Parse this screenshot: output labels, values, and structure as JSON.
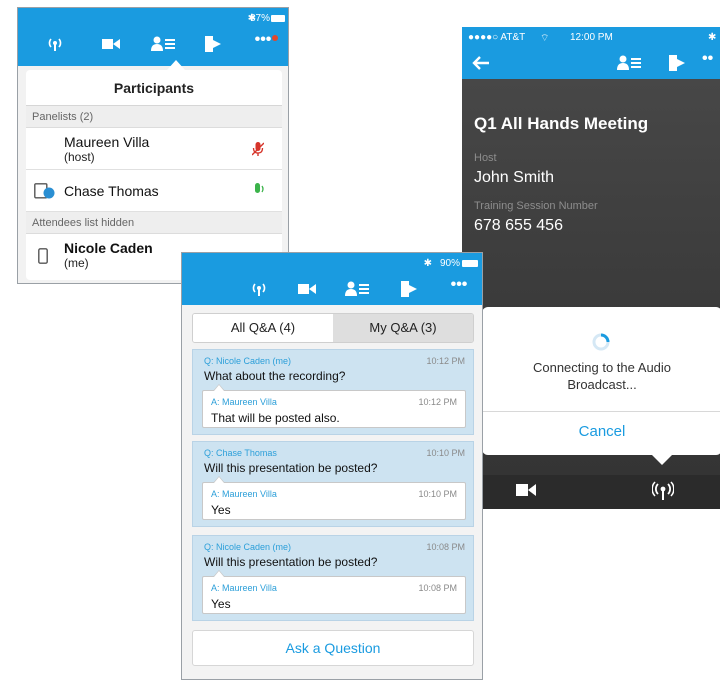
{
  "colors": {
    "accent": "#1a9be0",
    "question_bg": "#cde3f1",
    "dark_bg": "#3a3a3a"
  },
  "participants_screen": {
    "status": {
      "battery": "87%"
    },
    "toolbar_icons": [
      "audio-broadcast-icon",
      "video-icon",
      "participants-icon",
      "leave-icon",
      "more-icon"
    ],
    "title": "Participants",
    "panelists_header": "Panelists (2)",
    "panelists": [
      {
        "name": "Maureen Villa",
        "sub": "(host)",
        "mic": "muted-mic-icon"
      },
      {
        "name": "Chase Thomas",
        "sub": "",
        "mic": "active-mic-icon"
      }
    ],
    "attendees_header": "Attendees list hidden",
    "me": {
      "name": "Nicole Caden",
      "sub": "(me)"
    }
  },
  "meeting_screen": {
    "status": {
      "carrier": "●●●●○ AT&T",
      "time": "12:00 PM"
    },
    "title": "Q1 All Hands Meeting",
    "host_label": "Host",
    "host_value": "John Smith",
    "session_label": "Training Session Number",
    "session_value": "678 655 456",
    "dialog": {
      "message": "Connecting to the Audio Broadcast...",
      "cancel": "Cancel"
    }
  },
  "qa_screen": {
    "status": {
      "battery": "90%"
    },
    "tabs": [
      {
        "label": "All Q&A (4)"
      },
      {
        "label": "My Q&A (3)"
      }
    ],
    "items": [
      {
        "q_from": "Q: Nicole Caden (me)",
        "q_time": "10:12 PM",
        "q_text": "What about the recording?",
        "a_from": "A: Maureen Villa",
        "a_time": "10:12 PM",
        "a_text": "That will be posted also."
      },
      {
        "q_from": "Q: Chase Thomas",
        "q_time": "10:10 PM",
        "q_text": "Will this presentation be posted?",
        "a_from": "A: Maureen Villa",
        "a_time": "10:10 PM",
        "a_text": "Yes"
      },
      {
        "q_from": "Q: Nicole Caden (me)",
        "q_time": "10:08 PM",
        "q_text": "Will this presentation be posted?",
        "a_from": "A: Maureen Villa",
        "a_time": "10:08 PM",
        "a_text": "Yes"
      }
    ],
    "ask_button": "Ask a Question"
  }
}
